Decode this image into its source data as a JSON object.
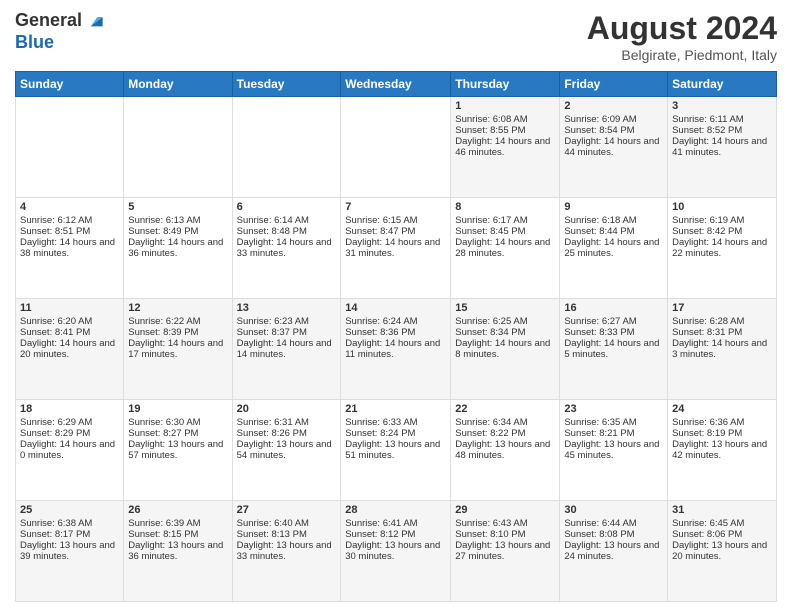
{
  "header": {
    "logo_line1": "General",
    "logo_line2": "Blue",
    "month_title": "August 2024",
    "location": "Belgirate, Piedmont, Italy"
  },
  "days_of_week": [
    "Sunday",
    "Monday",
    "Tuesday",
    "Wednesday",
    "Thursday",
    "Friday",
    "Saturday"
  ],
  "weeks": [
    [
      {
        "day": "",
        "text": ""
      },
      {
        "day": "",
        "text": ""
      },
      {
        "day": "",
        "text": ""
      },
      {
        "day": "",
        "text": ""
      },
      {
        "day": "1",
        "text": "Sunrise: 6:08 AM\nSunset: 8:55 PM\nDaylight: 14 hours and 46 minutes."
      },
      {
        "day": "2",
        "text": "Sunrise: 6:09 AM\nSunset: 8:54 PM\nDaylight: 14 hours and 44 minutes."
      },
      {
        "day": "3",
        "text": "Sunrise: 6:11 AM\nSunset: 8:52 PM\nDaylight: 14 hours and 41 minutes."
      }
    ],
    [
      {
        "day": "4",
        "text": "Sunrise: 6:12 AM\nSunset: 8:51 PM\nDaylight: 14 hours and 38 minutes."
      },
      {
        "day": "5",
        "text": "Sunrise: 6:13 AM\nSunset: 8:49 PM\nDaylight: 14 hours and 36 minutes."
      },
      {
        "day": "6",
        "text": "Sunrise: 6:14 AM\nSunset: 8:48 PM\nDaylight: 14 hours and 33 minutes."
      },
      {
        "day": "7",
        "text": "Sunrise: 6:15 AM\nSunset: 8:47 PM\nDaylight: 14 hours and 31 minutes."
      },
      {
        "day": "8",
        "text": "Sunrise: 6:17 AM\nSunset: 8:45 PM\nDaylight: 14 hours and 28 minutes."
      },
      {
        "day": "9",
        "text": "Sunrise: 6:18 AM\nSunset: 8:44 PM\nDaylight: 14 hours and 25 minutes."
      },
      {
        "day": "10",
        "text": "Sunrise: 6:19 AM\nSunset: 8:42 PM\nDaylight: 14 hours and 22 minutes."
      }
    ],
    [
      {
        "day": "11",
        "text": "Sunrise: 6:20 AM\nSunset: 8:41 PM\nDaylight: 14 hours and 20 minutes."
      },
      {
        "day": "12",
        "text": "Sunrise: 6:22 AM\nSunset: 8:39 PM\nDaylight: 14 hours and 17 minutes."
      },
      {
        "day": "13",
        "text": "Sunrise: 6:23 AM\nSunset: 8:37 PM\nDaylight: 14 hours and 14 minutes."
      },
      {
        "day": "14",
        "text": "Sunrise: 6:24 AM\nSunset: 8:36 PM\nDaylight: 14 hours and 11 minutes."
      },
      {
        "day": "15",
        "text": "Sunrise: 6:25 AM\nSunset: 8:34 PM\nDaylight: 14 hours and 8 minutes."
      },
      {
        "day": "16",
        "text": "Sunrise: 6:27 AM\nSunset: 8:33 PM\nDaylight: 14 hours and 5 minutes."
      },
      {
        "day": "17",
        "text": "Sunrise: 6:28 AM\nSunset: 8:31 PM\nDaylight: 14 hours and 3 minutes."
      }
    ],
    [
      {
        "day": "18",
        "text": "Sunrise: 6:29 AM\nSunset: 8:29 PM\nDaylight: 14 hours and 0 minutes."
      },
      {
        "day": "19",
        "text": "Sunrise: 6:30 AM\nSunset: 8:27 PM\nDaylight: 13 hours and 57 minutes."
      },
      {
        "day": "20",
        "text": "Sunrise: 6:31 AM\nSunset: 8:26 PM\nDaylight: 13 hours and 54 minutes."
      },
      {
        "day": "21",
        "text": "Sunrise: 6:33 AM\nSunset: 8:24 PM\nDaylight: 13 hours and 51 minutes."
      },
      {
        "day": "22",
        "text": "Sunrise: 6:34 AM\nSunset: 8:22 PM\nDaylight: 13 hours and 48 minutes."
      },
      {
        "day": "23",
        "text": "Sunrise: 6:35 AM\nSunset: 8:21 PM\nDaylight: 13 hours and 45 minutes."
      },
      {
        "day": "24",
        "text": "Sunrise: 6:36 AM\nSunset: 8:19 PM\nDaylight: 13 hours and 42 minutes."
      }
    ],
    [
      {
        "day": "25",
        "text": "Sunrise: 6:38 AM\nSunset: 8:17 PM\nDaylight: 13 hours and 39 minutes."
      },
      {
        "day": "26",
        "text": "Sunrise: 6:39 AM\nSunset: 8:15 PM\nDaylight: 13 hours and 36 minutes."
      },
      {
        "day": "27",
        "text": "Sunrise: 6:40 AM\nSunset: 8:13 PM\nDaylight: 13 hours and 33 minutes."
      },
      {
        "day": "28",
        "text": "Sunrise: 6:41 AM\nSunset: 8:12 PM\nDaylight: 13 hours and 30 minutes."
      },
      {
        "day": "29",
        "text": "Sunrise: 6:43 AM\nSunset: 8:10 PM\nDaylight: 13 hours and 27 minutes."
      },
      {
        "day": "30",
        "text": "Sunrise: 6:44 AM\nSunset: 8:08 PM\nDaylight: 13 hours and 24 minutes."
      },
      {
        "day": "31",
        "text": "Sunrise: 6:45 AM\nSunset: 8:06 PM\nDaylight: 13 hours and 20 minutes."
      }
    ]
  ]
}
